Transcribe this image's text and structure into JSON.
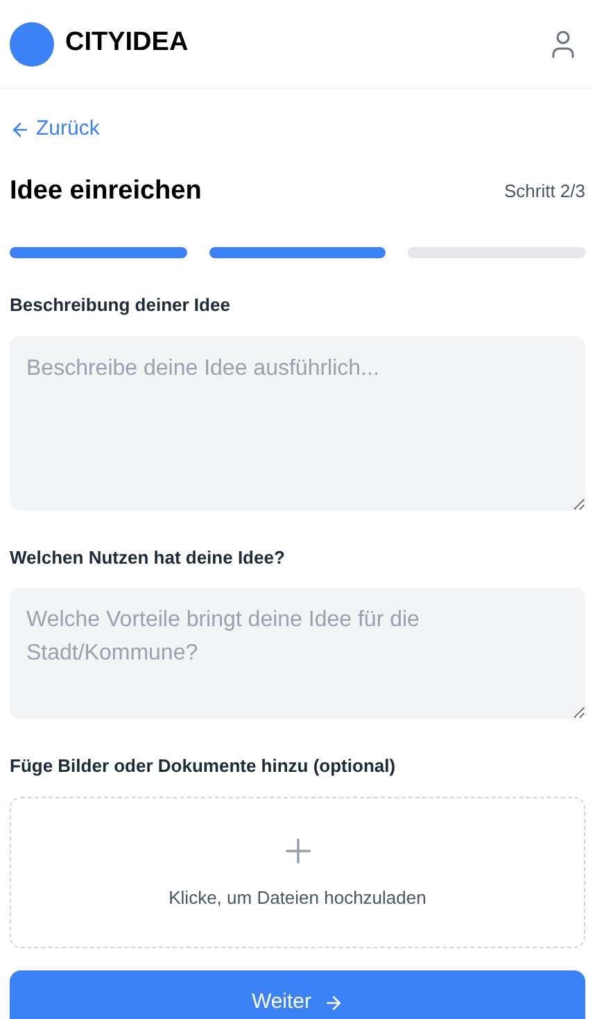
{
  "header": {
    "logo_text": "CITYIDEA"
  },
  "back_link": {
    "label": "Zurück"
  },
  "title": "Idee einreichen",
  "step_label": "Schritt 2/3",
  "progress": [
    {
      "completed": true
    },
    {
      "completed": true
    },
    {
      "completed": false
    }
  ],
  "fields": [
    {
      "kind": "long_text",
      "label": "Beschreibung deiner Idee",
      "placeholder": "Beschreibe deine Idee ausführlich..."
    },
    {
      "kind": "short_text",
      "label": "Welchen Nutzen hat deine Idee?",
      "placeholder": "Welche Vorteile bringt deine Idee für die Stadt/Kommune?"
    },
    {
      "kind": "upload",
      "label": "Füge Bilder oder Dokumente hinzu (optional)",
      "hint": "Klicke, um Dateien hochzuladen"
    }
  ],
  "submit": {
    "label": "Weiter"
  }
}
